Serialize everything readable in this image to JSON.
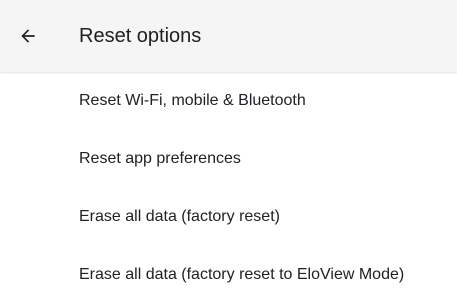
{
  "header": {
    "back_icon": "arrow-back-icon",
    "title": "Reset options"
  },
  "items": [
    {
      "label": "Reset Wi-Fi, mobile & Bluetooth"
    },
    {
      "label": "Reset app preferences"
    },
    {
      "label": "Erase all data (factory reset)"
    },
    {
      "label": "Erase all data (factory reset to EloView Mode)"
    }
  ],
  "colors": {
    "app_bar_background": "#f5f5f5",
    "background": "#ffffff",
    "text": "#202124"
  }
}
